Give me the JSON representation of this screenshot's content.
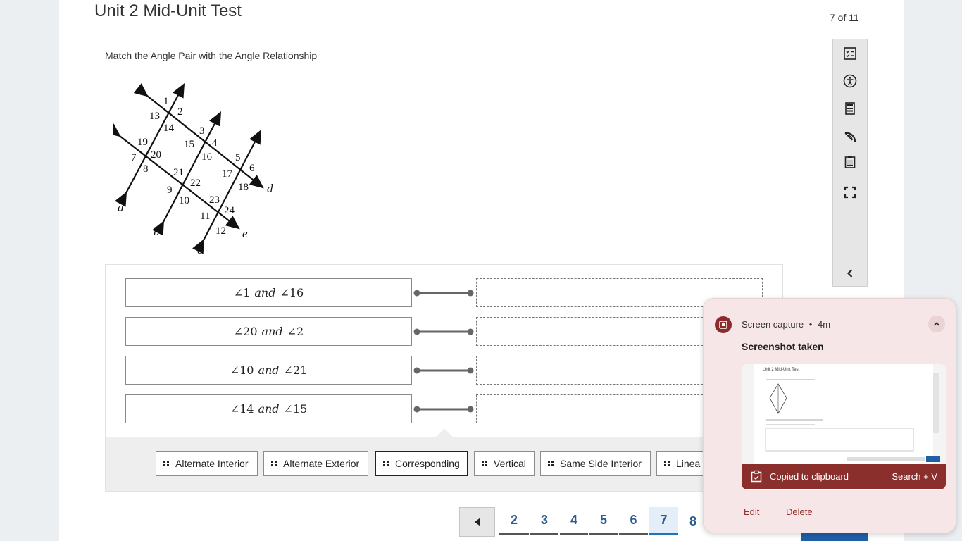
{
  "header": {
    "title": "Unit 2 Mid-Unit Test",
    "page_count": "7 of 11"
  },
  "question": {
    "prompt": "Match the Angle Pair with the Angle Relationship",
    "diagram_labels": {
      "angles": [
        "1",
        "2",
        "13",
        "14",
        "3",
        "4",
        "15",
        "16",
        "5",
        "6",
        "17",
        "18",
        "19",
        "20",
        "7",
        "8",
        "21",
        "22",
        "9",
        "10",
        "23",
        "24",
        "11",
        "12"
      ],
      "lines": [
        "a",
        "b",
        "c",
        "d",
        "e"
      ]
    }
  },
  "pairs": [
    {
      "a": "∠1",
      "and": "and",
      "b": "∠16"
    },
    {
      "a": "∠20",
      "and": "and",
      "b": "∠2"
    },
    {
      "a": "∠10",
      "and": "and",
      "b": "∠21"
    },
    {
      "a": "∠14",
      "and": "and",
      "b": "∠15"
    }
  ],
  "answer_bank": [
    "Alternate Interior",
    "Alternate Exterior",
    "Corresponding",
    "Vertical",
    "Same Side Interior",
    "Linea"
  ],
  "toolbar": [
    "checklist-icon",
    "accessibility-icon",
    "calculator-icon",
    "protractor-icon",
    "notepad-icon",
    "fullscreen-icon",
    "chevron-left-icon"
  ],
  "pagination": {
    "pages": [
      "2",
      "3",
      "4",
      "5",
      "6",
      "7",
      "8"
    ],
    "current": "7"
  },
  "notification": {
    "app": "Screen capture",
    "dot": "•",
    "time": "4m",
    "title": "Screenshot taken",
    "copied": "Copied to clipboard",
    "shortcut": "Search + V",
    "edit": "Edit",
    "delete": "Delete",
    "thumbnail_title": "Unit 2 Mid-Unit Test"
  },
  "colors": {
    "accent": "#1f73b7",
    "toast_bg": "#f7e6e8",
    "toast_brand": "#8a2f2c",
    "link": "#2a5d8f"
  }
}
